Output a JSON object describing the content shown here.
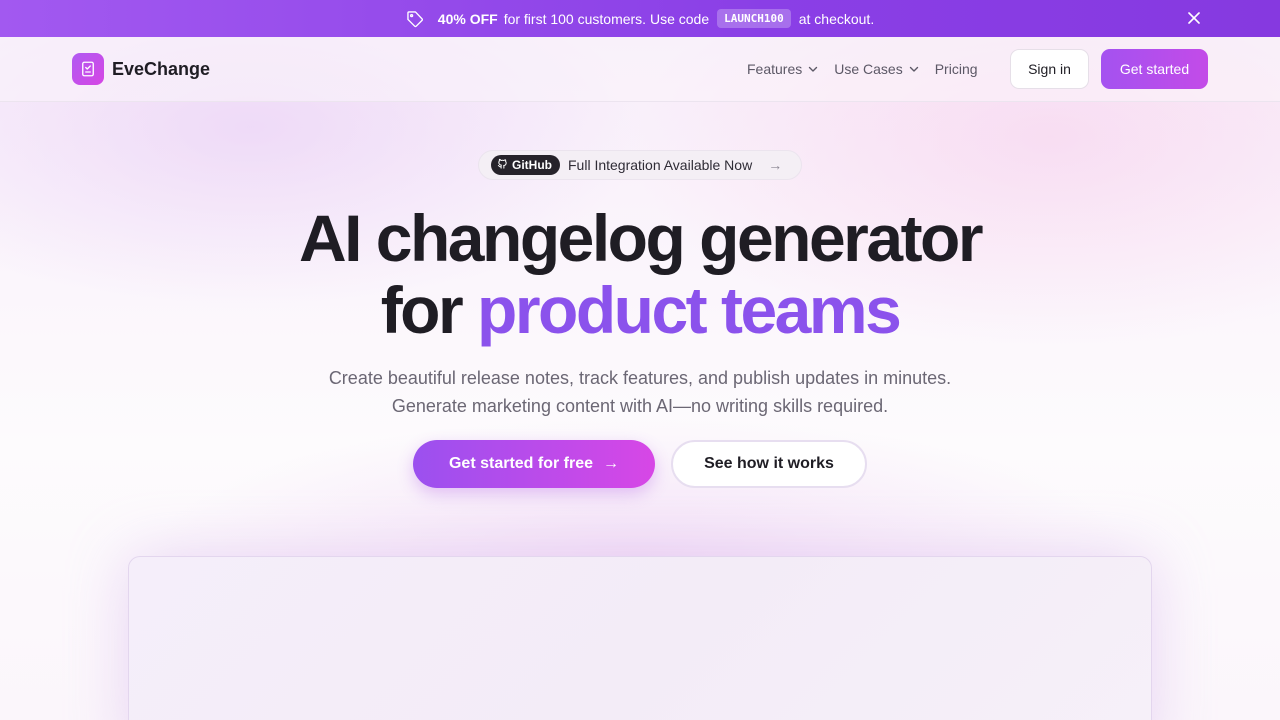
{
  "promo": {
    "highlight": "40% OFF",
    "text_before_code": "for first 100 customers. Use code",
    "code": "LAUNCH100",
    "text_after_code": "at checkout.",
    "icon": "tag-icon",
    "close_icon": "close-icon"
  },
  "nav": {
    "brand": "EveChange",
    "links": [
      {
        "label": "Features",
        "has_dropdown": true
      },
      {
        "label": "Use Cases",
        "has_dropdown": true
      },
      {
        "label": "Pricing",
        "has_dropdown": false
      }
    ],
    "sign_in": "Sign in",
    "get_started": "Get started"
  },
  "hero": {
    "badge_label": "GitHub",
    "badge_text": "Full Integration Available Now",
    "badge_arrow": "→",
    "title_line1": "AI changelog generator",
    "title_line2_prefix": "for",
    "title_line2_accent": "product teams",
    "subtitle_line1": "Create beautiful release notes, track features, and publish updates in minutes.",
    "subtitle_line2": "Generate marketing content with AI—no writing skills required.",
    "cta_primary": "Get started for free",
    "cta_primary_arrow": "→",
    "cta_secondary": "See how it works"
  },
  "colors": {
    "accent": "#8b52ec",
    "promo_bg": "#8a3fe6",
    "cta_gradient_start": "#9b50ef",
    "cta_gradient_end": "#d747e6"
  }
}
